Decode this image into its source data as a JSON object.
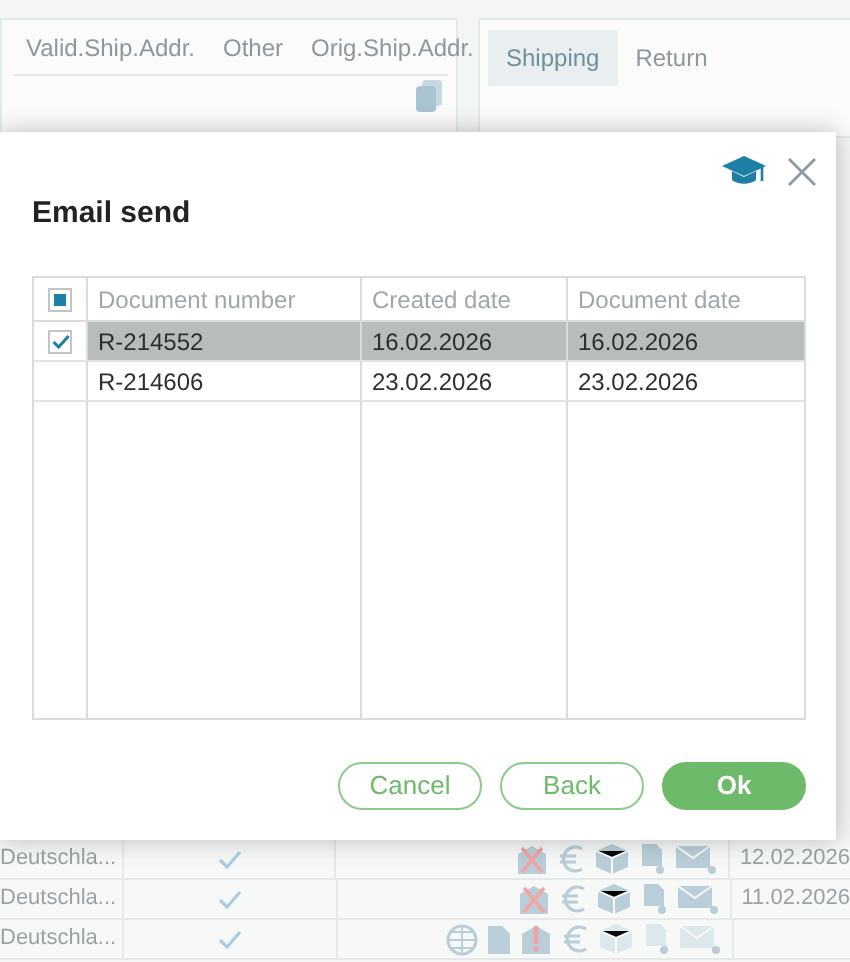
{
  "background": {
    "left_tabs": [
      {
        "label": "Valid.Ship.Addr.",
        "selected": false
      },
      {
        "label": "Other",
        "selected": false
      },
      {
        "label": "Orig.Ship.Addr.",
        "selected": false
      }
    ],
    "right_tabs": [
      {
        "label": "Shipping",
        "selected": true
      },
      {
        "label": "Return",
        "selected": false
      }
    ],
    "rows": [
      {
        "country": "Deutschla...",
        "checked": true,
        "kind": "cancelled",
        "date": "12.02.2026"
      },
      {
        "country": "Deutschla...",
        "checked": true,
        "kind": "cancelled",
        "date": "11.02.2026"
      },
      {
        "country": "Deutschla...",
        "checked": true,
        "kind": "warning"
      }
    ]
  },
  "dialog": {
    "title": "Email send",
    "select_all": {
      "indeterminate": true
    },
    "columns": [
      "Document number",
      "Created date",
      "Document date"
    ],
    "rows": [
      {
        "selected": true,
        "cells": [
          "R-214552",
          "16.02.2026",
          "16.02.2026"
        ]
      },
      {
        "selected": false,
        "cells": [
          "R-214606",
          "23.02.2026",
          "23.02.2026"
        ]
      }
    ],
    "buttons": [
      {
        "label": "Cancel",
        "kind": "outline"
      },
      {
        "label": "Back",
        "kind": "outline"
      },
      {
        "label": "Ok",
        "kind": "primary"
      }
    ]
  }
}
